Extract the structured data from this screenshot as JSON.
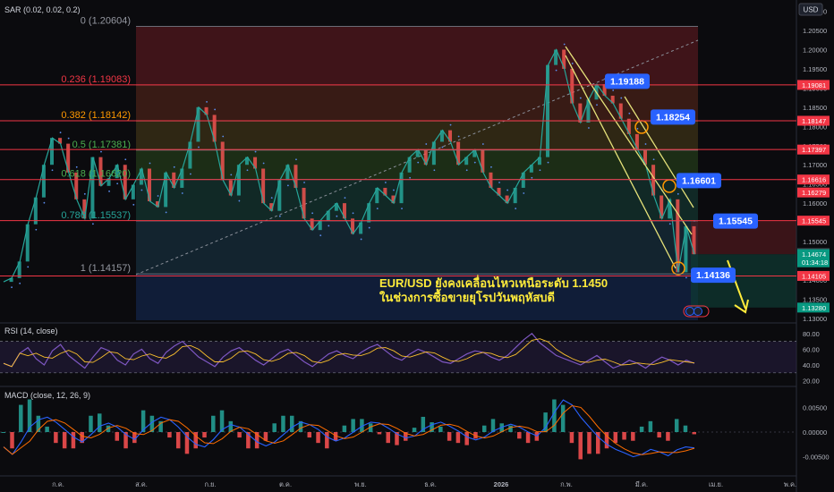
{
  "indicators": {
    "sar": "SAR (0.02, 0.02, 0.2)",
    "rsi": "RSI (14, close)",
    "macd": "MACD (close, 12, 26, 9)"
  },
  "currency": "USD",
  "headline": {
    "line1": "EUR/USD ยังคงเคลื่อนไหวเหนือระดับ 1.1450",
    "line2": "ในช่วงการซื้อขายยุโรปวันพฤหัสบดี"
  },
  "chart_data": [
    {
      "type": "line",
      "panel": "price",
      "title": "",
      "x_labels": [
        "ก.ค.",
        "ส.ค.",
        "ก.ย.",
        "ต.ค.",
        "พ.ย.",
        "ธ.ค.",
        "2026",
        "ก.พ.",
        "มี.ค.",
        "เม.ย.",
        "พ.ค."
      ],
      "y_ticks": [
        "1.21000",
        "1.20500",
        "1.20000",
        "1.19500",
        "1.19000",
        "1.18500",
        "1.18000",
        "1.17500",
        "1.17000",
        "1.16500",
        "1.16000",
        "1.15500",
        "1.15000",
        "1.14500",
        "1.14000",
        "1.13500",
        "1.13000"
      ],
      "ylim": [
        1.1295,
        1.212
      ],
      "fibonacci": [
        {
          "ratio": "0",
          "label": "0 (1.20604)",
          "price": 1.20604
        },
        {
          "ratio": "0.236",
          "label": "0.236 (1.19083)",
          "price": 1.19083
        },
        {
          "ratio": "0.382",
          "label": "0.382 (1.18142)",
          "price": 1.18142
        },
        {
          "ratio": "0.5",
          "label": "0.5 (1.17381)",
          "price": 1.17381
        },
        {
          "ratio": "0.618",
          "label": "0.618 (1.16620)",
          "price": 1.1662
        },
        {
          "ratio": "0.786",
          "label": "0.786 (1.15537)",
          "price": 1.15537
        },
        {
          "ratio": "1",
          "label": "1 (1.14157)",
          "price": 1.14157
        }
      ],
      "horizontal_levels": [
        {
          "label": "1.19081",
          "price": 1.19081
        },
        {
          "label": "1.18147",
          "price": 1.18147
        },
        {
          "label": "1.17397",
          "price": 1.17397
        },
        {
          "label": "1.16616",
          "price": 1.16616
        },
        {
          "label": "1.15545",
          "price": 1.15545
        },
        {
          "label": "1.14105",
          "price": 1.14105
        }
      ],
      "price_tags": [
        {
          "label": "1.16279",
          "price": 1.16279,
          "color": "#f23645"
        },
        {
          "label": "1.14703",
          "price": 1.14703,
          "color": "#3a3d45"
        },
        {
          "label": "1.14674",
          "price": 1.14674,
          "color": "#089981"
        },
        {
          "label": "01:34:18",
          "price": 1.1446,
          "color": "#089981"
        },
        {
          "label": "1.13280",
          "price": 1.1328,
          "color": "#089981"
        }
      ],
      "callouts": [
        {
          "label": "1.19188",
          "price": 1.19188
        },
        {
          "label": "1.18254",
          "price": 1.18254
        },
        {
          "label": "1.16601",
          "price": 1.16601
        },
        {
          "label": "1.15545",
          "price": 1.15545
        },
        {
          "label": "1.14136",
          "price": 1.14136
        }
      ],
      "series": [
        {
          "values": [
            1.1395,
            1.1405,
            1.1448,
            1.1545,
            1.1615,
            1.17,
            1.177,
            1.1755,
            1.168,
            1.161,
            1.156,
            1.172,
            1.1645,
            1.1665,
            1.17,
            1.161,
            1.1648,
            1.169,
            1.1605,
            1.159,
            1.168,
            1.164,
            1.169,
            1.176,
            1.185,
            1.183,
            1.176,
            1.166,
            1.162,
            1.17,
            1.172,
            1.169,
            1.16,
            1.158,
            1.166,
            1.17,
            1.164,
            1.156,
            1.153,
            1.1555,
            1.158,
            1.16,
            1.156,
            1.152,
            1.155,
            1.16,
            1.164,
            1.162,
            1.16,
            1.168,
            1.172,
            1.174,
            1.17,
            1.176,
            1.179,
            1.176,
            1.17,
            1.172,
            1.174,
            1.168,
            1.164,
            1.162,
            1.16,
            1.164,
            1.168,
            1.17,
            1.172,
            1.196,
            1.2,
            1.195,
            1.186,
            1.181,
            1.187,
            1.191,
            1.188,
            1.186,
            1.182,
            1.178,
            1.174,
            1.17,
            1.162,
            1.156,
            1.161,
            1.142,
            1.154,
            1.1467
          ]
        }
      ]
    },
    {
      "type": "line",
      "panel": "rsi",
      "title": "RSI (14, close)",
      "y_ticks": [
        "80.00",
        "60.00",
        "40.00",
        "20.00"
      ],
      "levels": [
        70,
        30
      ],
      "ylim": [
        15,
        90
      ],
      "series": [
        {
          "values": [
            42,
            38,
            55,
            62,
            48,
            40,
            58,
            66,
            52,
            44,
            36,
            50,
            62,
            58,
            46,
            40,
            54,
            60,
            48,
            42,
            56,
            64,
            70,
            60,
            50,
            44,
            38,
            50,
            58,
            62,
            54,
            46,
            40,
            48,
            56,
            60,
            52,
            44,
            38,
            46,
            54,
            58,
            52,
            48,
            56,
            62,
            66,
            58,
            50,
            46,
            54,
            60,
            56,
            50,
            44,
            42,
            48,
            54,
            58,
            56,
            50,
            46,
            52,
            62,
            72,
            80,
            68,
            60,
            52,
            48,
            44,
            40,
            46,
            52,
            44,
            36,
            40,
            46,
            42,
            36,
            44,
            50,
            46,
            40,
            46,
            42
          ]
        }
      ]
    },
    {
      "type": "bar",
      "panel": "macd",
      "title": "MACD (close, 12, 26, 9)",
      "y_ticks": [
        "0.00500",
        "0.00000",
        "-0.00500"
      ],
      "ylim": [
        -0.0085,
        0.0085
      ],
      "series": [
        {
          "values": [
            -0.003,
            -0.0045,
            -0.002,
            0.001,
            0.0025,
            0.003,
            0.002,
            0.0005,
            -0.001,
            -0.002,
            -0.0005,
            0.0012,
            0.0018,
            0.001,
            -0.0005,
            -0.0015,
            0.0005,
            0.002,
            0.003,
            0.0025,
            0.001,
            -0.001,
            -0.0025,
            -0.003,
            -0.0015,
            0.0005,
            0.0015,
            0.001,
            -0.0005,
            -0.002,
            -0.0028,
            -0.002,
            -0.0005,
            0.001,
            0.002,
            0.0015,
            0.0005,
            -0.001,
            -0.0018,
            -0.0012,
            0.0,
            0.0012,
            0.002,
            0.0018,
            0.0008,
            -0.0004,
            -0.0012,
            -0.0008,
            0.0006,
            0.0015,
            0.002,
            0.0012,
            0.0002,
            -0.001,
            -0.0016,
            -0.001,
            0.0002,
            0.001,
            0.0016,
            0.001,
            0.0,
            -0.0008,
            0.001,
            0.004,
            0.0065,
            0.0055,
            0.003,
            0.001,
            -0.001,
            -0.0025,
            -0.0035,
            -0.0042,
            -0.005,
            -0.0045,
            -0.0035,
            -0.004,
            -0.0048,
            -0.0036,
            -0.003,
            -0.0032
          ]
        }
      ]
    }
  ]
}
